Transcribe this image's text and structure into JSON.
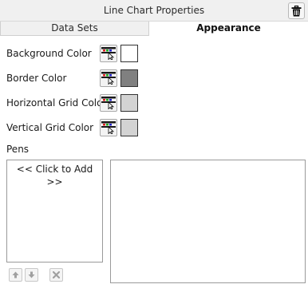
{
  "window": {
    "title": "Line Chart Properties",
    "delete_icon": "trash-icon"
  },
  "tabs": [
    {
      "label": "Data Sets",
      "active": false
    },
    {
      "label": "Appearance",
      "active": true
    }
  ],
  "properties": [
    {
      "label": "Background Color",
      "color": "#ffffff",
      "picker_icon": "color-picker-icon"
    },
    {
      "label": "Border Color",
      "color": "#808080",
      "picker_icon": "color-picker-icon"
    },
    {
      "label": "Horizontal Grid Color",
      "color": "#d3d3d3",
      "picker_icon": "color-picker-icon"
    },
    {
      "label": "Vertical Grid Color",
      "color": "#d3d3d3",
      "picker_icon": "color-picker-icon"
    }
  ],
  "pens": {
    "label": "Pens",
    "list_items": [
      "<< Click to Add >>"
    ],
    "buttons": [
      {
        "icon": "arrow-up-icon",
        "enabled": false
      },
      {
        "icon": "arrow-down-icon",
        "enabled": false
      },
      {
        "icon": "delete-x-icon",
        "enabled": false
      }
    ]
  }
}
